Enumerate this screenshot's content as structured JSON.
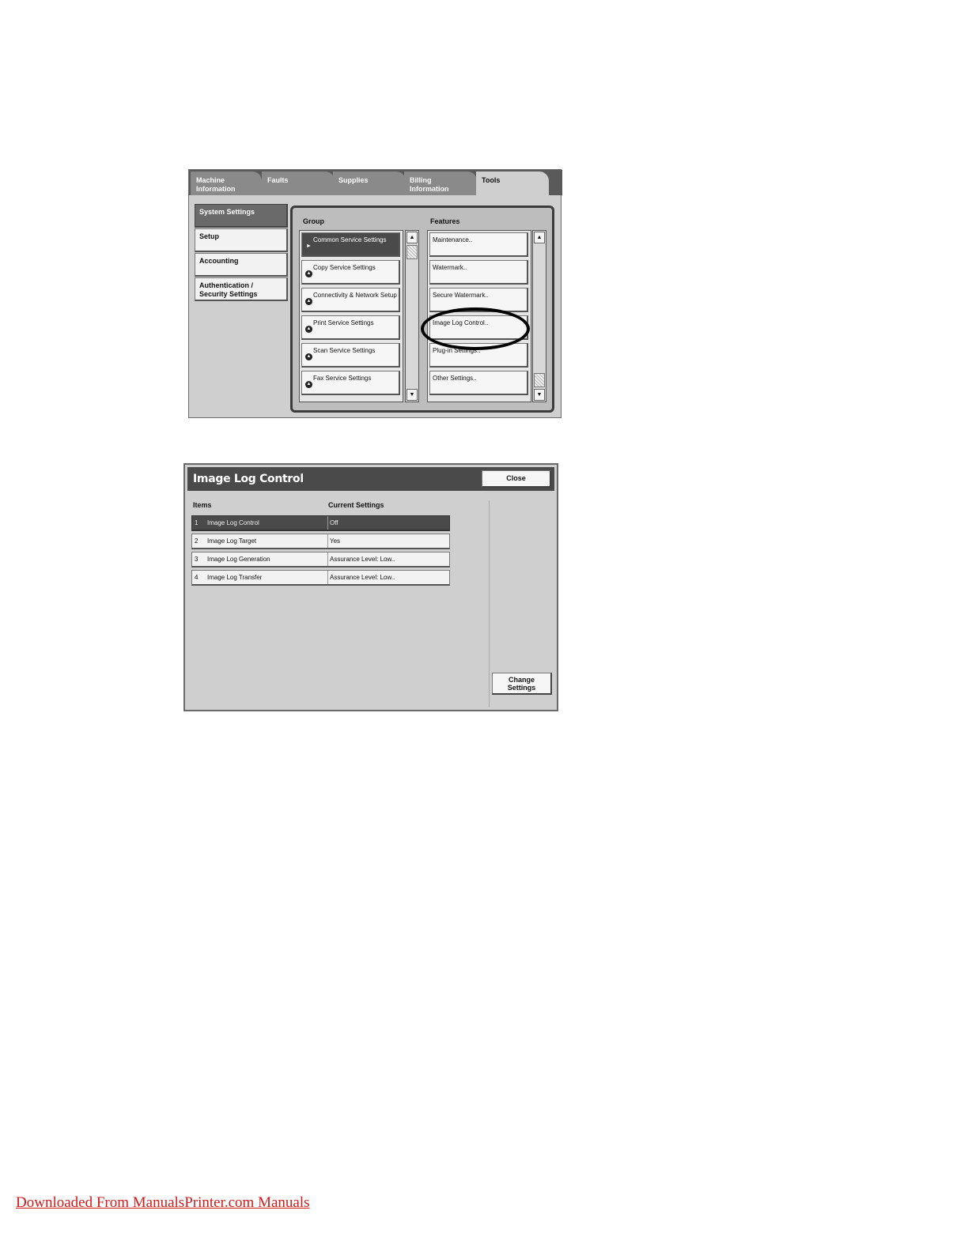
{
  "screen1": {
    "tabs": [
      {
        "label_line1": "Machine",
        "label_line2": "Information"
      },
      {
        "label_line1": "Faults",
        "label_line2": ""
      },
      {
        "label_line1": "Supplies",
        "label_line2": ""
      },
      {
        "label_line1": "Billing",
        "label_line2": "Information"
      },
      {
        "label_line1": "Tools",
        "label_line2": ""
      }
    ],
    "active_tab": "Tools",
    "left_nav": [
      {
        "line1": "System Settings",
        "line2": ""
      },
      {
        "line1": "Setup",
        "line2": ""
      },
      {
        "line1": "Accounting",
        "line2": ""
      },
      {
        "line1": "Authentication /",
        "line2": "Security Settings"
      }
    ],
    "group_header": "Group",
    "features_header": "Features",
    "groups": [
      "Common Service Settings",
      "Copy Service Settings",
      "Connectivity & Network Setup",
      "Print Service Settings",
      "Scan Service Settings",
      "Fax Service Settings"
    ],
    "features": [
      "Maintenance..",
      "Watermark..",
      "Secure Watermark..",
      "Image Log Control..",
      "Plug-in Settings..",
      "Other Settings.."
    ],
    "scroll_up_glyph": "▲",
    "scroll_down_glyph": "▼",
    "selected_marker": "►",
    "group_marker": "▲"
  },
  "screen2": {
    "title": "Image Log Control",
    "close_label": "Close",
    "col_items": "Items",
    "col_current": "Current Settings",
    "rows": [
      {
        "num": "1",
        "item": "Image Log Control",
        "value": "Off"
      },
      {
        "num": "2",
        "item": "Image Log Target",
        "value": "Yes"
      },
      {
        "num": "3",
        "item": "Image Log Generation",
        "value": "Assurance Level: Low.."
      },
      {
        "num": "4",
        "item": "Image Log Transfer",
        "value": "Assurance Level: Low.."
      }
    ],
    "change_line1": "Change",
    "change_line2": "Settings"
  },
  "footer_link": "Downloaded From ManualsPrinter.com Manuals",
  "colors": {
    "panel": "#cfcfcf",
    "selected": "#4a4a4a",
    "link": "#d21a1a"
  }
}
